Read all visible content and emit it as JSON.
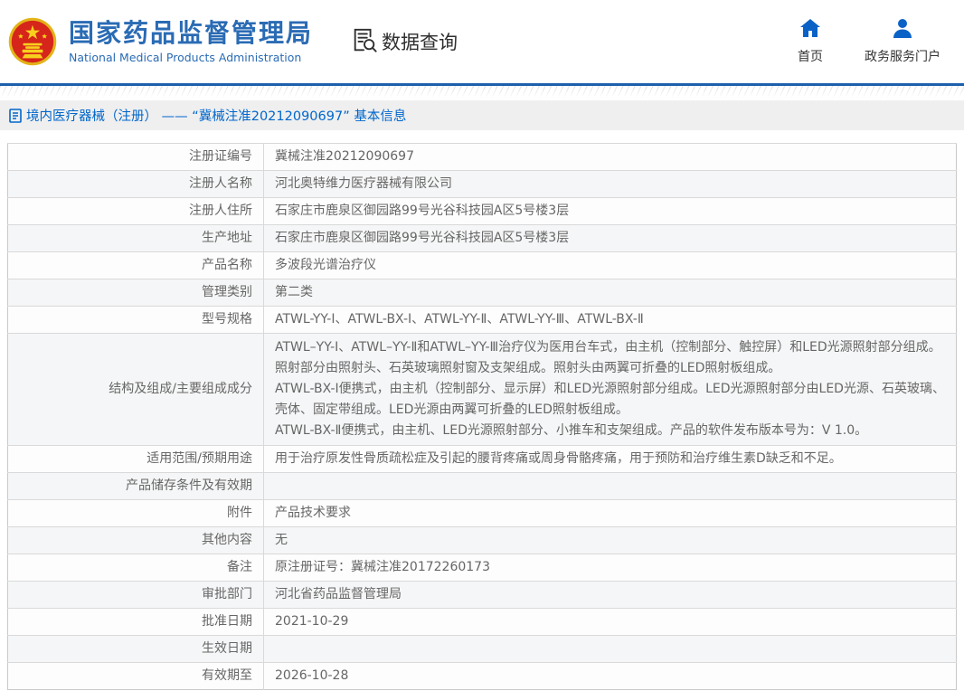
{
  "header": {
    "brand": {
      "emblem_icon": "china-national-emblem",
      "title": "国家药品监督管理局",
      "subtitle": "National Medical Products Administration",
      "title_color": "#2a6bb4"
    },
    "data_query": {
      "icon": "document-search-icon",
      "label": "数据查询"
    },
    "nav": [
      {
        "icon": "home-icon",
        "label": "首页"
      },
      {
        "icon": "user-icon",
        "label": "政务服务门户"
      }
    ],
    "accent_color": "#1d60ad",
    "icon_color": "#0b62c6"
  },
  "breadcrumb": {
    "icon": "document-icon",
    "text": "境内医疗器械（注册） —— “冀械注准20212090697” 基本信息",
    "link_color": "#0066cc"
  },
  "table": {
    "rows": [
      {
        "label": "注册证编号",
        "value": "冀械注准20212090697"
      },
      {
        "label": "注册人名称",
        "value": "河北奥特维力医疗器械有限公司"
      },
      {
        "label": "注册人住所",
        "value": "石家庄市鹿泉区御园路99号光谷科技园A区5号楼3层"
      },
      {
        "label": "生产地址",
        "value": "石家庄市鹿泉区御园路99号光谷科技园A区5号楼3层"
      },
      {
        "label": "产品名称",
        "value": "多波段光谱治疗仪"
      },
      {
        "label": "管理类别",
        "value": "第二类"
      },
      {
        "label": "型号规格",
        "value": "ATWL-YY-Ⅰ、ATWL-BX-Ⅰ、ATWL-YY-Ⅱ、ATWL-YY-Ⅲ、ATWL-BX-Ⅱ"
      },
      {
        "label": "结构及组成/主要组成成分",
        "value_lines": [
          "ATWL–YY-Ⅰ、ATWL–YY-Ⅱ和ATWL–YY-Ⅲ治疗仪为医用台车式，由主机（控制部分、触控屏）和LED光源照射部分组成。照射部分由照射头、石英玻璃照射窗及支架组成。照射头由两翼可折叠的LED照射板组成。",
          "ATWL-BX-Ⅰ便携式，由主机（控制部分、显示屏）和LED光源照射部分组成。LED光源照射部分由LED光源、石英玻璃、壳体、固定带组成。LED光源由两翼可折叠的LED照射板组成。",
          "ATWL-BX-Ⅱ便携式，由主机、LED光源照射部分、小推车和支架组成。产品的软件发布版本号为：V 1.0。"
        ]
      },
      {
        "label": "适用范围/预期用途",
        "value": "用于治疗原发性骨质疏松症及引起的腰背疼痛或周身骨骼疼痛，用于预防和治疗维生素D缺乏和不足。"
      },
      {
        "label": "产品储存条件及有效期",
        "value": ""
      },
      {
        "label": "附件",
        "value": "产品技术要求"
      },
      {
        "label": "其他内容",
        "value": "无"
      },
      {
        "label": "备注",
        "value": "原注册证号：冀械注准20172260173"
      },
      {
        "label": "审批部门",
        "value": "河北省药品监督管理局"
      },
      {
        "label": "批准日期",
        "value": "2021-10-29"
      },
      {
        "label": "生效日期",
        "value": ""
      },
      {
        "label": "有效期至",
        "value": "2026-10-28"
      }
    ]
  }
}
